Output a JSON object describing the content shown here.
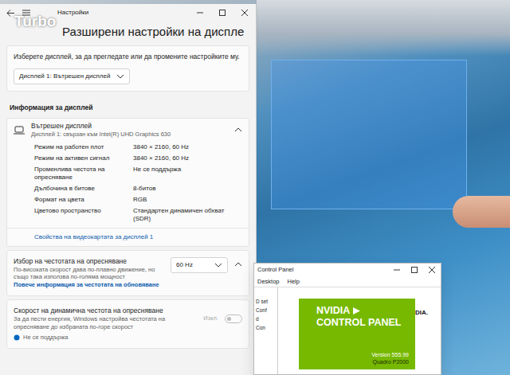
{
  "watermark": "Turbo",
  "settings": {
    "title": "Настройки",
    "heading": "Разширени настройки на диспле",
    "picker": {
      "prompt": "Изберете дисплей, за да прегледате или да промените настройките му.",
      "value": "Дисплей 1: Вътрешен дисплей",
      "expanded": false
    },
    "info_heading": "Информация за дисплей",
    "display": {
      "name": "Вътрешен дисплей",
      "subtitle": "Дисплей 1: свързан към Intel(R) UHD Graphics 630",
      "expanded": true,
      "rows": [
        {
          "label": "Режим на работен плот",
          "value": "3840 × 2160, 60 Hz"
        },
        {
          "label": "Режим на активен сигнал",
          "value": "3840 × 2160, 60 Hz"
        },
        {
          "label": "Променлива честота на опресняване",
          "value": "Не се поддържа"
        },
        {
          "label": "Дълбочина в битове",
          "value": "8-битов"
        },
        {
          "label": "Формат на цвета",
          "value": "RGB"
        },
        {
          "label": "Цветово пространство",
          "value": "Стандартен динамичен обхват (SDR)"
        }
      ],
      "link": "Свойства на видеокартата за дисплей 1"
    },
    "refresh": {
      "title": "Избор на честотата на опресняване",
      "description": "По-високата скорост дава по-плавно движение, но също така използва по-голяма мощност",
      "link": "Повече информация за честотата на обновяване",
      "value": "60 Hz",
      "expanded": true
    },
    "dynamic": {
      "title": "Скорост на динамична честота на опресняване",
      "description": "За да пести енергия, Windows настройва честотата на опресняване до избраната по-горе скорост",
      "toggle_label": "Изкл.",
      "on": false,
      "disabled": true,
      "note": "Не се поддържа"
    }
  },
  "nvidia": {
    "title": "Control Panel",
    "menu": [
      "Desktop",
      "Help"
    ],
    "tree": [
      "D set",
      "Conf",
      "d",
      "Con"
    ],
    "brand": "NVIDIA",
    "product": "CONTROL PANEL",
    "version": "Version 555.99",
    "gpu": "Quadro P2000",
    "logo_fragment": "DIA."
  }
}
